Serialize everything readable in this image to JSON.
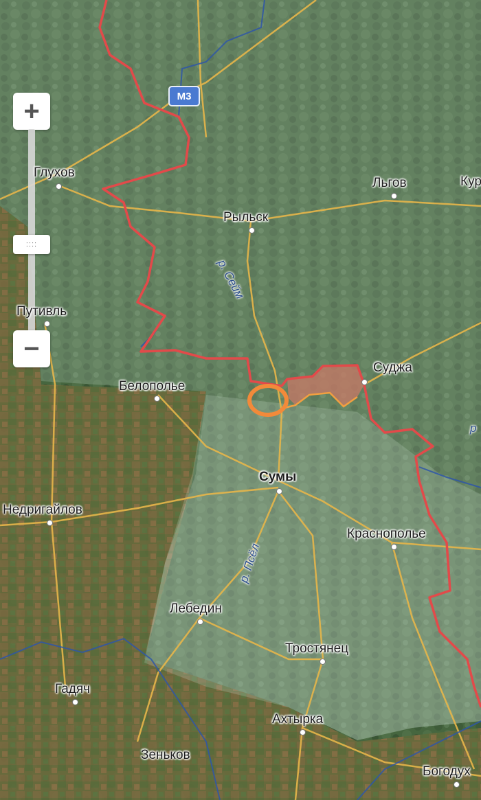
{
  "controls": {
    "zoom_in_symbol": "+",
    "zoom_out_symbol": "−",
    "zoom_handle_symbol": "::::"
  },
  "road_shield": "М3",
  "cities": [
    {
      "name": "Глухов"
    },
    {
      "name": "Льгов"
    },
    {
      "name": "Кур"
    },
    {
      "name": "Рыльск"
    },
    {
      "name": "Путивль"
    },
    {
      "name": "Суджа"
    },
    {
      "name": "Белополье"
    },
    {
      "name": "Сумы"
    },
    {
      "name": "Недригайлов"
    },
    {
      "name": "Краснополье"
    },
    {
      "name": "Лебедин"
    },
    {
      "name": "Тростянец"
    },
    {
      "name": "Гадяч"
    },
    {
      "name": "Ахтырка"
    },
    {
      "name": "Зеньков"
    },
    {
      "name": "Богодух"
    }
  ],
  "rivers": [
    {
      "name": "р. Сейм"
    },
    {
      "name": "р. Псёл"
    },
    {
      "name": "р"
    }
  ],
  "colors": {
    "border": "#e24a4a",
    "roads": "#e7b64a",
    "rivers": "#2e56a8",
    "occupied_area": "#c97a67",
    "marker_circle": "#f28a3a"
  }
}
